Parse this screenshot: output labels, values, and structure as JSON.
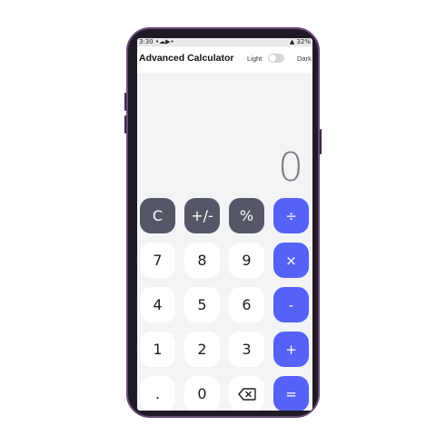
{
  "status": {
    "left": "3:30",
    "right": "32%"
  },
  "header": {
    "title": "Advanced Calculator",
    "light_label": "Light",
    "dark_label": "Dark"
  },
  "display": {
    "value": "0"
  },
  "keys": {
    "clear": "C",
    "sign": "+/-",
    "percent": "%",
    "divide": "÷",
    "seven": "7",
    "eight": "8",
    "nine": "9",
    "multiply": "×",
    "four": "4",
    "five": "5",
    "six": "6",
    "subtract": "-",
    "one": "1",
    "two": "2",
    "three": "3",
    "add": "+",
    "dot": ".",
    "zero": "0",
    "equals": "="
  }
}
